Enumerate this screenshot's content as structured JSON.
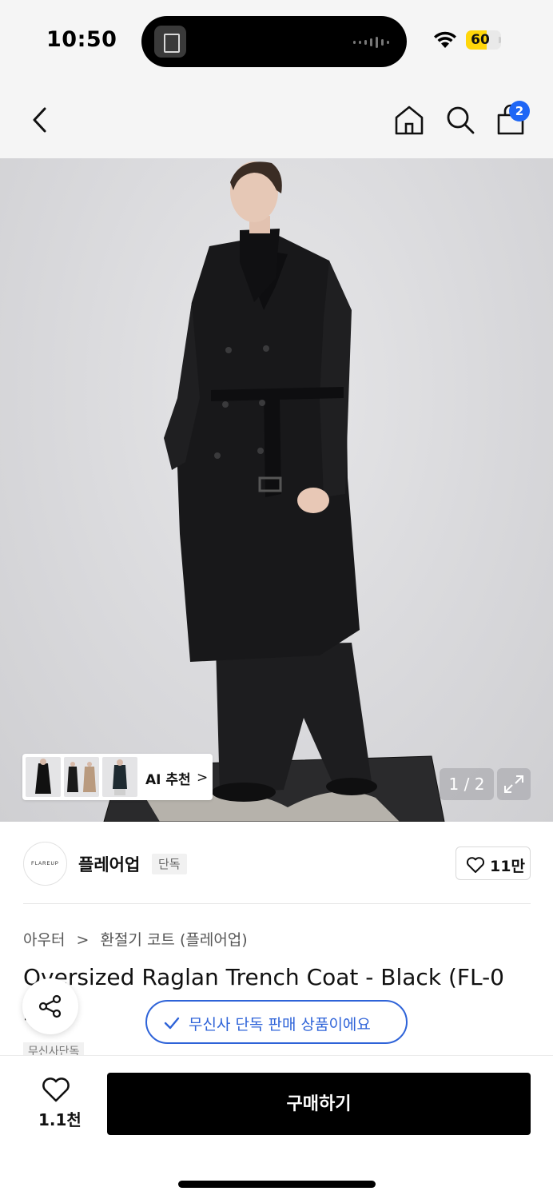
{
  "status_bar": {
    "time": "10:50",
    "battery": "60",
    "battery_fraction": 0.6,
    "battery_color": "#ffd60a"
  },
  "nav": {
    "back_icon": "chevron-left-icon",
    "home_icon": "home-icon",
    "search_icon": "search-icon",
    "cart_icon": "shopping-bag-icon",
    "cart_badge": "2",
    "badge_color": "#1e66f5"
  },
  "gallery": {
    "ai_recommend_label": "AI 추천",
    "ai_recommend_chevron": ">",
    "counter": "1 / 2",
    "expand_icon": "expand-icon"
  },
  "brand": {
    "logo_text": "FLAREUP",
    "name": "플레어업",
    "tag": "단독",
    "like_count": "11만"
  },
  "breadcrumb": {
    "items": [
      "아우터",
      "환절기 코트 (플레어업)"
    ],
    "separator": ">"
  },
  "product": {
    "title": "Oversized Raglan Trench Coat - Black (FL-0",
    "title_line2": "2",
    "tag_peek": "무신사단독"
  },
  "exclusive_banner": {
    "text": "무신사 단독 판매 상품이에요",
    "accent_color": "#2e63d8"
  },
  "bottom_bar": {
    "wish_count": "1.1천",
    "buy_label": "구매하기"
  }
}
